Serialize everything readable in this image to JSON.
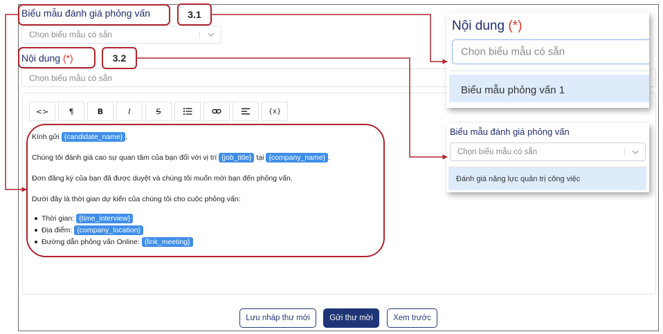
{
  "form": {
    "template_label": "Biểu mẫu đánh giá phỏng vấn",
    "template_placeholder": "Chọn biểu mẫu có sẵn",
    "content_label": "Nội dung",
    "required_mark": "(*)",
    "content_placeholder": "Chọn biểu mẫu có sẵn"
  },
  "annotations": {
    "badge_1": "3.1",
    "badge_2": "3.2"
  },
  "toolbar": {
    "code_label": "<>",
    "paragraph_label": "¶",
    "bold_label": "B",
    "italic_label": "I",
    "strike_label": "S",
    "variable_label": "{x}"
  },
  "email": {
    "greeting_prefix": "Kính gửi",
    "greeting_suffix": ",",
    "candidate_tag": "{candidate_name}",
    "line2_a": "Chúng tôi đánh giá cao sự quan tâm của bạn đối với vị trí",
    "job_tag": "{job_title}",
    "line2_b": "tại",
    "company_tag": "{company_name}",
    "line2_c": ".",
    "line3": "Đơn đăng ký của bạn đã được duyệt và chúng tôi muốn mời bạn đến phỏng vấn.",
    "line4": "Dưới đây là thời gian dự kiến của chúng tôi cho cuộc phỏng vấn:",
    "bullets": [
      {
        "label": "Thời gian:",
        "tag": "{time_interview}"
      },
      {
        "label": "Địa điểm:",
        "tag": "{company_location}"
      },
      {
        "label": "Đường dẫn phỏng vấn Online:",
        "tag": "{link_meeting}"
      }
    ]
  },
  "buttons": {
    "save_draft": "Lưu nháp thư mời",
    "send": "Gửi thư mời",
    "preview": "Xem trước"
  },
  "popup_content": {
    "label": "Nội dung",
    "required_mark": "(*)",
    "placeholder": "Chọn biểu mẫu có sẵn",
    "option": "Biểu mẫu phỏng vấn 1"
  },
  "popup_template": {
    "label": "Biểu mẫu đánh giá phỏng vấn",
    "placeholder": "Chọn biểu mẫu có sẵn",
    "option": "Đánh giá năng lực quản trị công việc"
  },
  "colors": {
    "annotation": "#b0242e",
    "primary": "#1e3576",
    "tag": "#3f8ee8",
    "option_highlight": "#deebfb"
  }
}
